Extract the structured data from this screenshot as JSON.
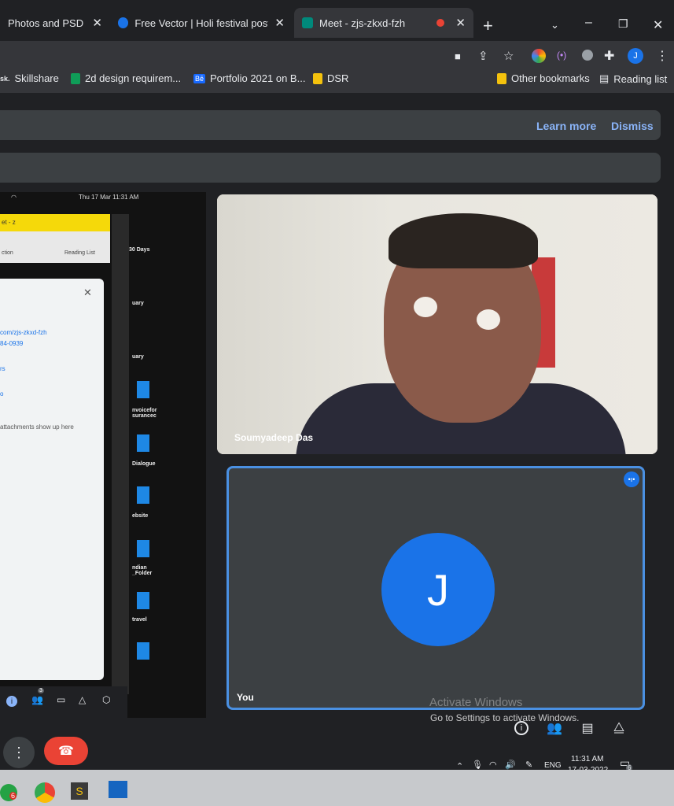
{
  "tabs": [
    {
      "title": "Photos and PSD fil",
      "favicon_color": "#4285f4"
    },
    {
      "title": "Free Vector | Holi festival poster",
      "favicon_color": "#1a73e8"
    },
    {
      "title": "Meet - zjs-zkxd-fzh",
      "favicon_color": "#00897b",
      "active": true
    }
  ],
  "new_tab_label": "+",
  "bookmarks": [
    {
      "label": "Skillshare",
      "prefix": "sk."
    },
    {
      "label": "2d design requirem...",
      "icon_color": "#0f9d58"
    },
    {
      "label": "Portfolio 2021 on B...",
      "prefix": "Bē",
      "icon_color": "#1769ff"
    },
    {
      "label": "DSR",
      "icon_color": "#f4c20d"
    }
  ],
  "other_bookmarks": "Other bookmarks",
  "reading_list": "Reading list",
  "banner": {
    "learn_more": "Learn more",
    "dismiss": "Dismiss"
  },
  "shared_screen": {
    "status_time": "Thu 17 Mar  11:31 AM",
    "inner_tab": "et - z",
    "inner_reading_list": "Reading List",
    "inner_ction": "ction",
    "panel_lines": [
      "com/zjs-zkxd-fzh",
      "84-0939",
      "rs",
      "o",
      "attachments show up here"
    ],
    "desktop_items": [
      "30 Days",
      "uary",
      "uary",
      "nvoicefor\nsurancec",
      "Dialogue",
      "ebsite",
      "ndian\n_Folder",
      "travel"
    ],
    "participants_badge": "3"
  },
  "participants": [
    {
      "name": "Soumyadeep Das"
    },
    {
      "name": "You",
      "initial": "J"
    }
  ],
  "activate_windows": {
    "title": "Activate Windows",
    "subtitle": "Go to Settings to activate Windows."
  },
  "system_tray": {
    "lang": "ENG",
    "time": "11:31 AM",
    "date": "17-03-2022",
    "notif_count": "6"
  },
  "taskbar_badge": "6",
  "colors": {
    "end_call": "#ea4335",
    "accent": "#1a73e8",
    "tile_border": "#4a90e2"
  }
}
